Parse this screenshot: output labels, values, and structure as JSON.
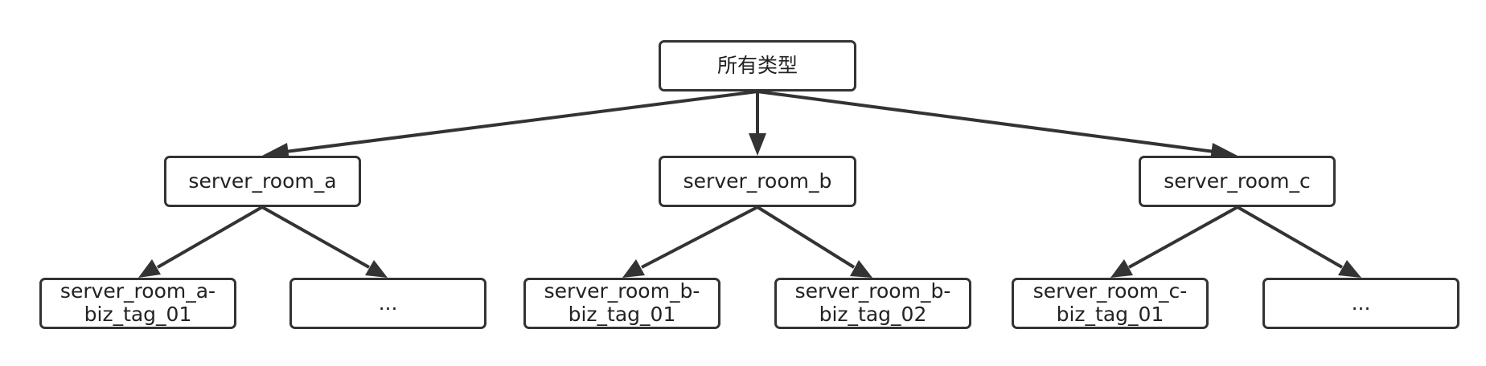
{
  "colors": {
    "stroke": "#333333",
    "text": "#222222",
    "background": "#ffffff"
  },
  "nodes": {
    "root": {
      "label": "所有类型"
    },
    "server_room_a": {
      "label": "server_room_a"
    },
    "server_room_b": {
      "label": "server_room_b"
    },
    "server_room_c": {
      "label": "server_room_c"
    },
    "a_child_1": {
      "line1": "server_room_a-",
      "line2": "biz_tag_01"
    },
    "a_child_2": {
      "label": "..."
    },
    "b_child_1": {
      "line1": "server_room_b-",
      "line2": "biz_tag_01"
    },
    "b_child_2": {
      "line1": "server_room_b-",
      "line2": "biz_tag_02"
    },
    "c_child_1": {
      "line1": "server_room_c-",
      "line2": "biz_tag_01"
    },
    "c_child_2": {
      "label": "..."
    }
  },
  "edges": [
    {
      "from": "root",
      "to": "server_room_a"
    },
    {
      "from": "root",
      "to": "server_room_b"
    },
    {
      "from": "root",
      "to": "server_room_c"
    },
    {
      "from": "server_room_a",
      "to": "a_child_1"
    },
    {
      "from": "server_room_a",
      "to": "a_child_2"
    },
    {
      "from": "server_room_b",
      "to": "b_child_1"
    },
    {
      "from": "server_room_b",
      "to": "b_child_2"
    },
    {
      "from": "server_room_c",
      "to": "c_child_1"
    },
    {
      "from": "server_room_c",
      "to": "c_child_2"
    }
  ]
}
